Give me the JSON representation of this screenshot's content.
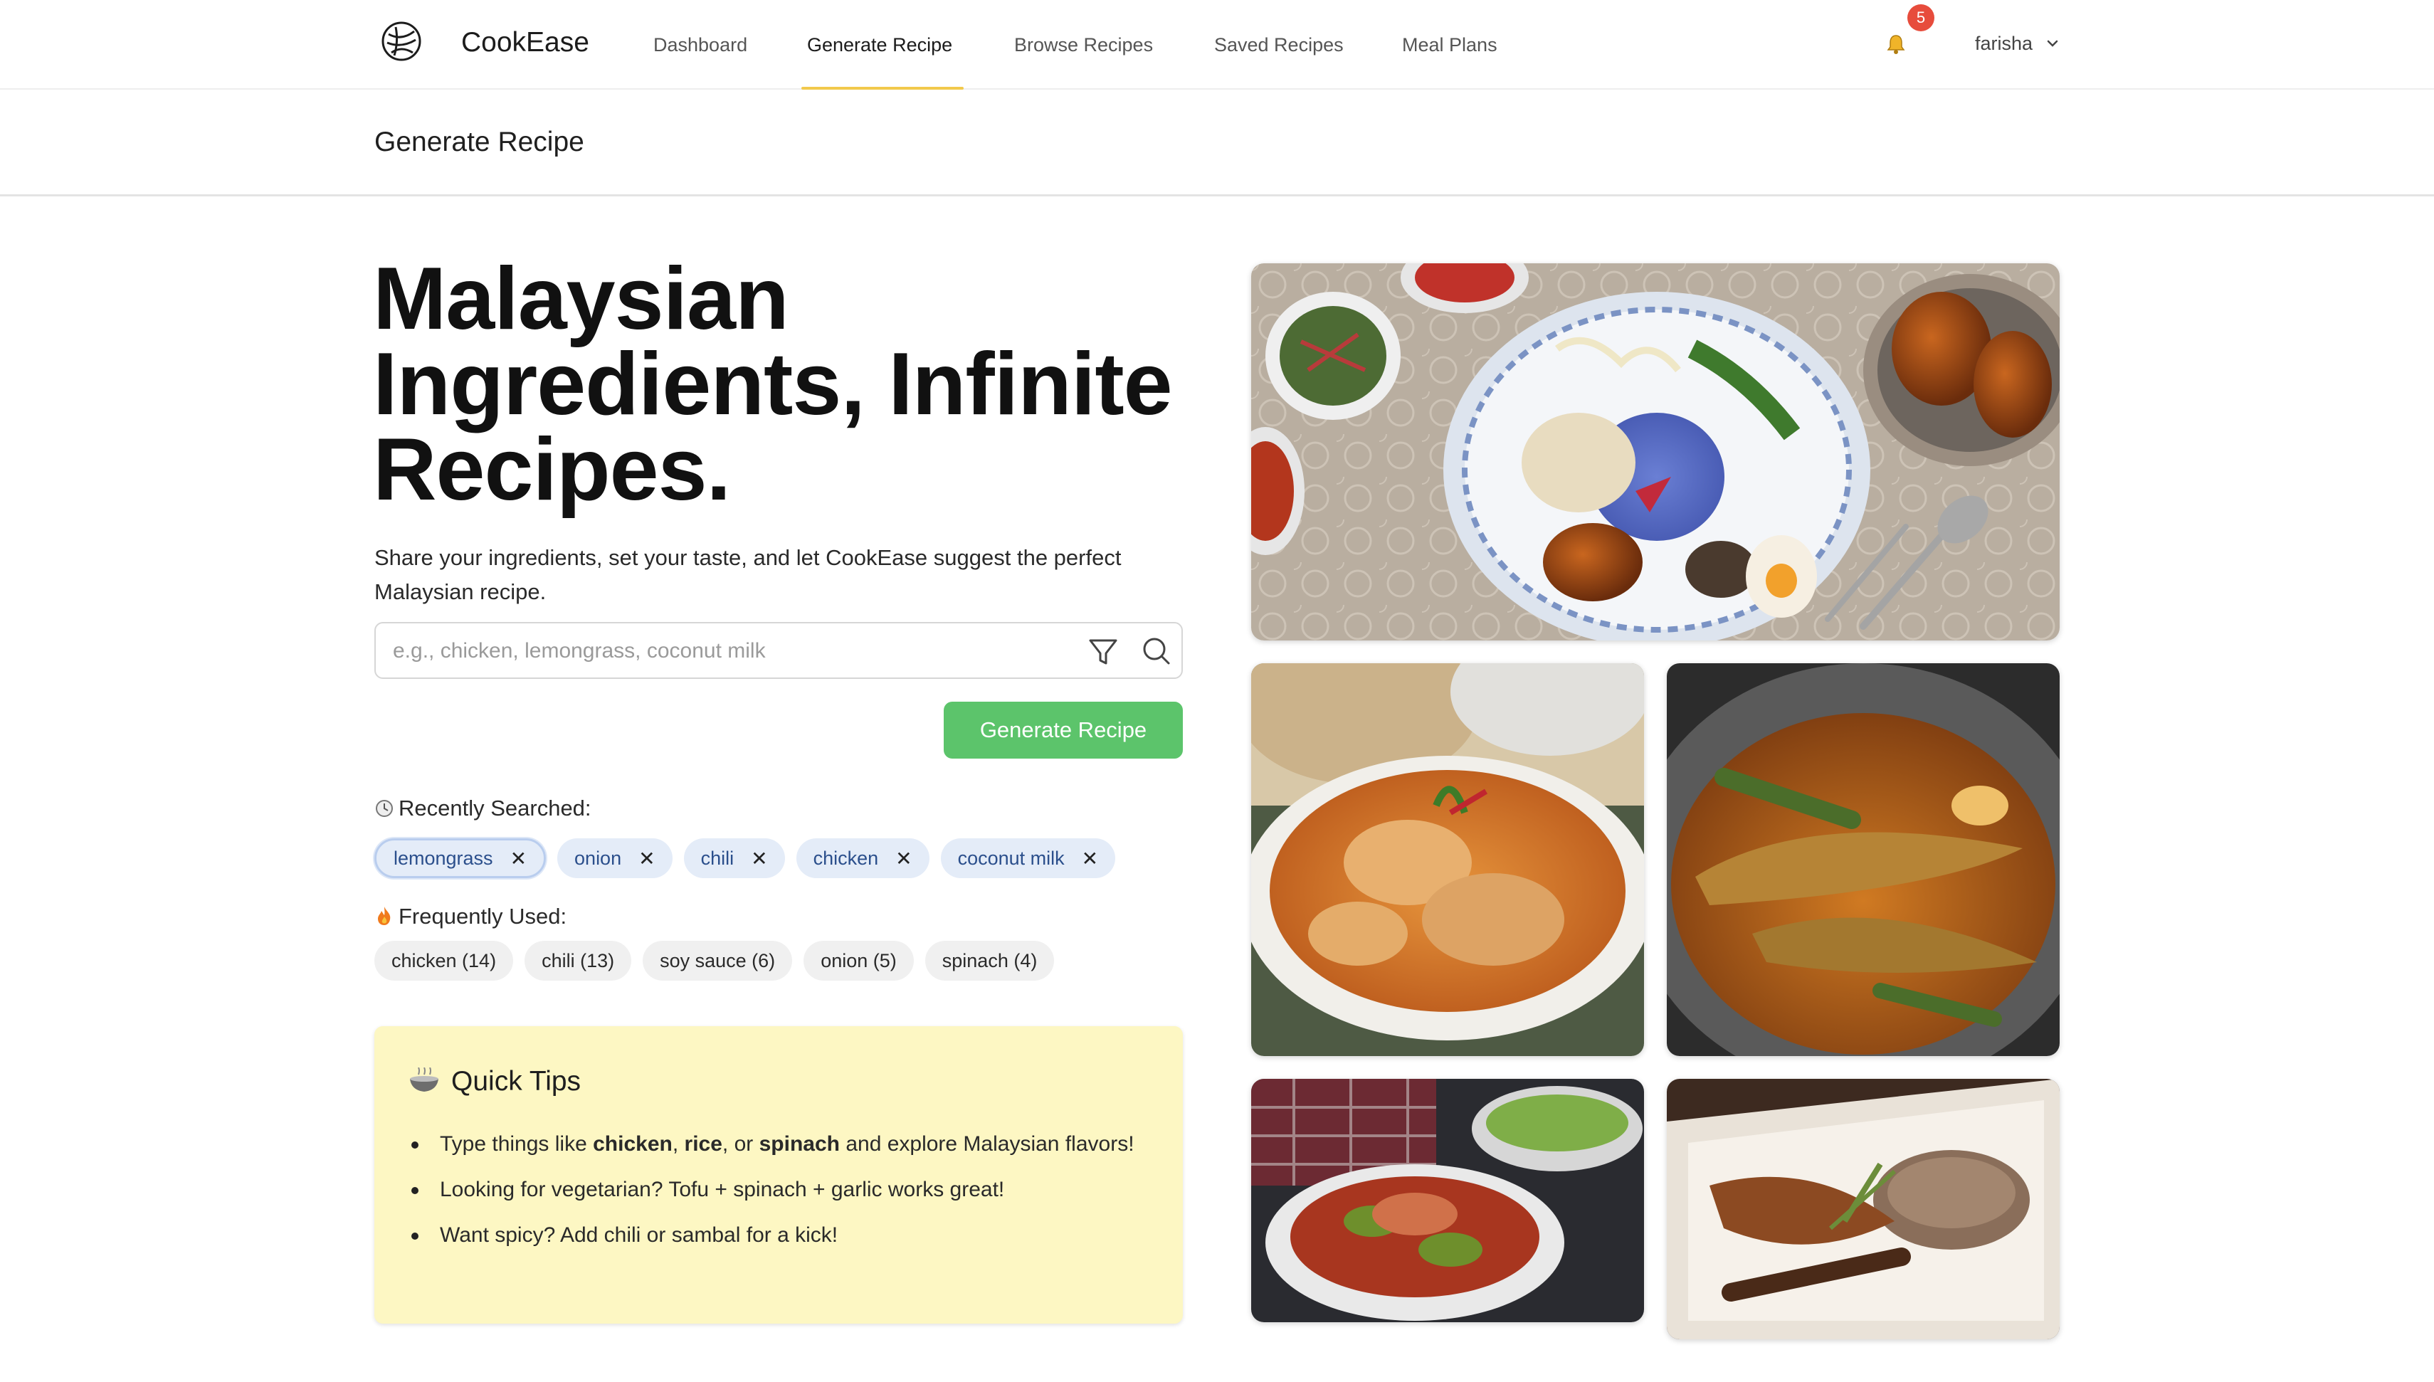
{
  "nav": {
    "brand": "CookEase",
    "items": [
      {
        "label": "Dashboard",
        "active": false
      },
      {
        "label": "Generate Recipe",
        "active": true
      },
      {
        "label": "Browse Recipes",
        "active": false
      },
      {
        "label": "Saved Recipes",
        "active": false
      },
      {
        "label": "Meal Plans",
        "active": false
      }
    ],
    "notifications": "5",
    "user": "farisha"
  },
  "page": {
    "title": "Generate Recipe"
  },
  "hero": {
    "title": "Malaysian Ingredients, Infinite Recipes.",
    "subtitle": "Share your ingredients, set your taste, and let CookEase suggest the perfect Malaysian recipe."
  },
  "search": {
    "placeholder": "e.g., chicken, lemongrass, coconut milk",
    "value": "",
    "button": "Generate Recipe"
  },
  "recent": {
    "label": "Recently Searched:",
    "icon": "clock-icon",
    "items": [
      "lemongrass",
      "onion",
      "chili",
      "chicken",
      "coconut milk"
    ],
    "selected_index": 0
  },
  "frequent": {
    "label": "Frequently Used:",
    "icon": "fire-icon",
    "items": [
      "chicken (14)",
      "chili (13)",
      "soy sauce (6)",
      "onion (5)",
      "spinach (4)"
    ]
  },
  "tips": {
    "title": "Quick Tips",
    "icon": "bowl-icon",
    "items": [
      {
        "parts": [
          [
            "Type things like ",
            false
          ],
          [
            "chicken",
            true
          ],
          [
            ", ",
            false
          ],
          [
            "rice",
            true
          ],
          [
            ", or ",
            false
          ],
          [
            "spinach",
            true
          ],
          [
            " and explore Malaysian flavors!",
            false
          ]
        ]
      },
      {
        "parts": [
          [
            "Looking for vegetarian? Tofu + spinach + garlic works great!",
            false
          ]
        ]
      },
      {
        "parts": [
          [
            "Want spicy? Add chili or sambal for a kick!",
            false
          ]
        ]
      }
    ]
  },
  "colors": {
    "accent_green": "#5cc46b",
    "active_underline": "#f2c94c",
    "badge_red": "#e74c3c",
    "recent_chip_bg": "#e4ecf8",
    "tips_bg": "#fdf7c3"
  },
  "photos": [
    "nasi-kerabu-photo",
    "chicken-curry-photo",
    "fish-curry-photo",
    "sambal-petai-photo",
    "grilled-fish-rice-photo"
  ]
}
